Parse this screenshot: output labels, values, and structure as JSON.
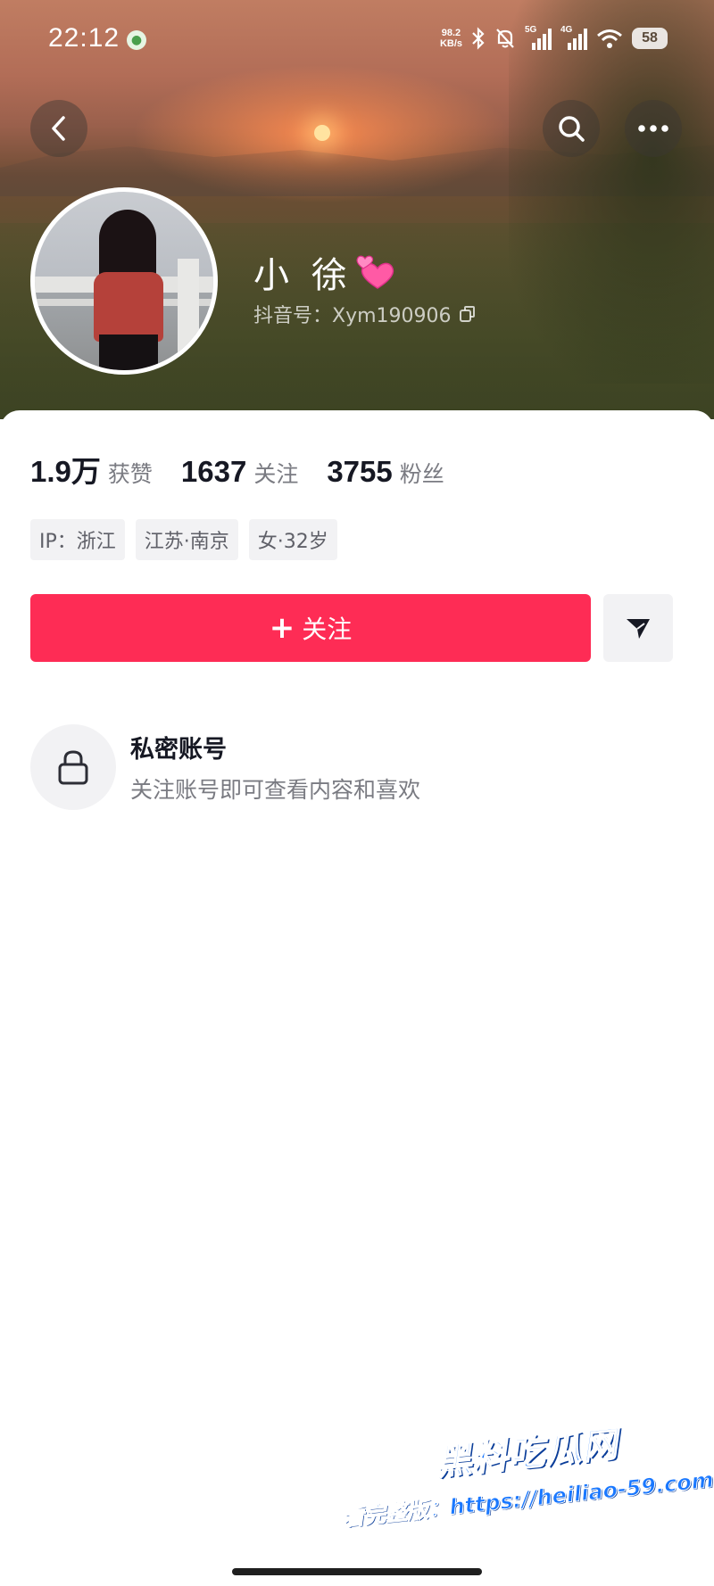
{
  "status_bar": {
    "time": "22:12",
    "net_speed_value": "98.2",
    "net_speed_unit": "KB/s",
    "signal1_tag": "5G",
    "signal2_tag": "4G",
    "battery": "58"
  },
  "profile": {
    "name": "小 徐",
    "name_emoji": "two-hearts-emoji",
    "douyin_id": "抖音号：Xym190906"
  },
  "stats": [
    {
      "value": "1.9万",
      "label": "获赞"
    },
    {
      "value": "1637",
      "label": "关注"
    },
    {
      "value": "3755",
      "label": "粉丝"
    }
  ],
  "tags": [
    "IP：浙江",
    "江苏·南京",
    "女·32岁"
  ],
  "actions": {
    "follow_label": "关注",
    "share_icon": "send-icon"
  },
  "private_notice": {
    "title": "私密账号",
    "description": "关注账号即可查看内容和喜欢"
  },
  "watermark": {
    "title": "黑料吃瓜网",
    "url": "看完整版：https://heiliao-59.com"
  },
  "colors": {
    "accent": "#fe2c55",
    "text_primary": "#161823",
    "text_secondary": "#7a7b82",
    "chip_bg": "#f2f2f4"
  }
}
